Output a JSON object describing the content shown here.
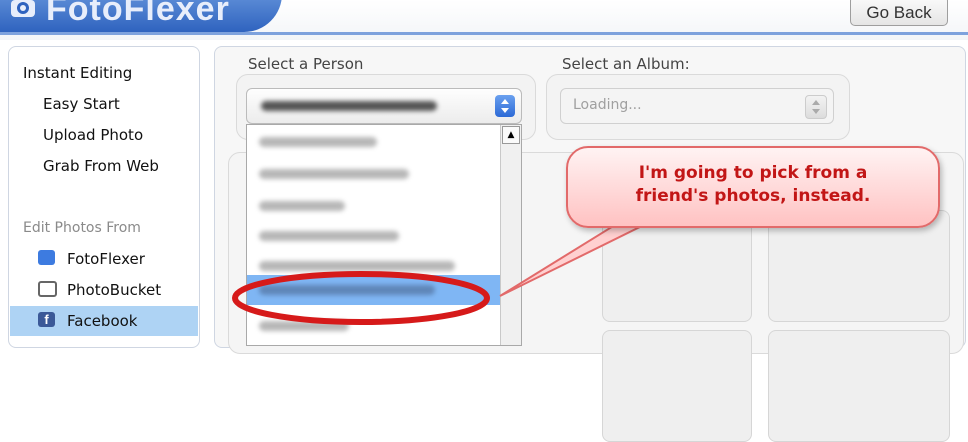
{
  "header": {
    "logo_text": "FotoFlexer",
    "go_back_label": "Go Back"
  },
  "sidebar": {
    "instant_editing": "Instant Editing",
    "easy_start": "Easy Start",
    "upload_photo": "Upload Photo",
    "grab_from_web": "Grab From Web",
    "edit_photos_from": "Edit Photos From",
    "sources": [
      {
        "label": "FotoFlexer",
        "icon": "fotoflexer-icon"
      },
      {
        "label": "PhotoBucket",
        "icon": "photobucket-icon"
      },
      {
        "label": "Facebook",
        "icon": "facebook-icon",
        "selected": true
      }
    ]
  },
  "main": {
    "select_person_label": "Select a Person",
    "select_album_label": "Select an Album:",
    "album_value": "Loading..."
  },
  "callout": {
    "text": "I'm going to pick from a\nfriend's photos, instead."
  },
  "colors": {
    "brand_blue": "#2f63bf",
    "highlight": "#7fb6f4",
    "callout_red": "#c21616",
    "ellipse_red": "#d61a1a"
  }
}
